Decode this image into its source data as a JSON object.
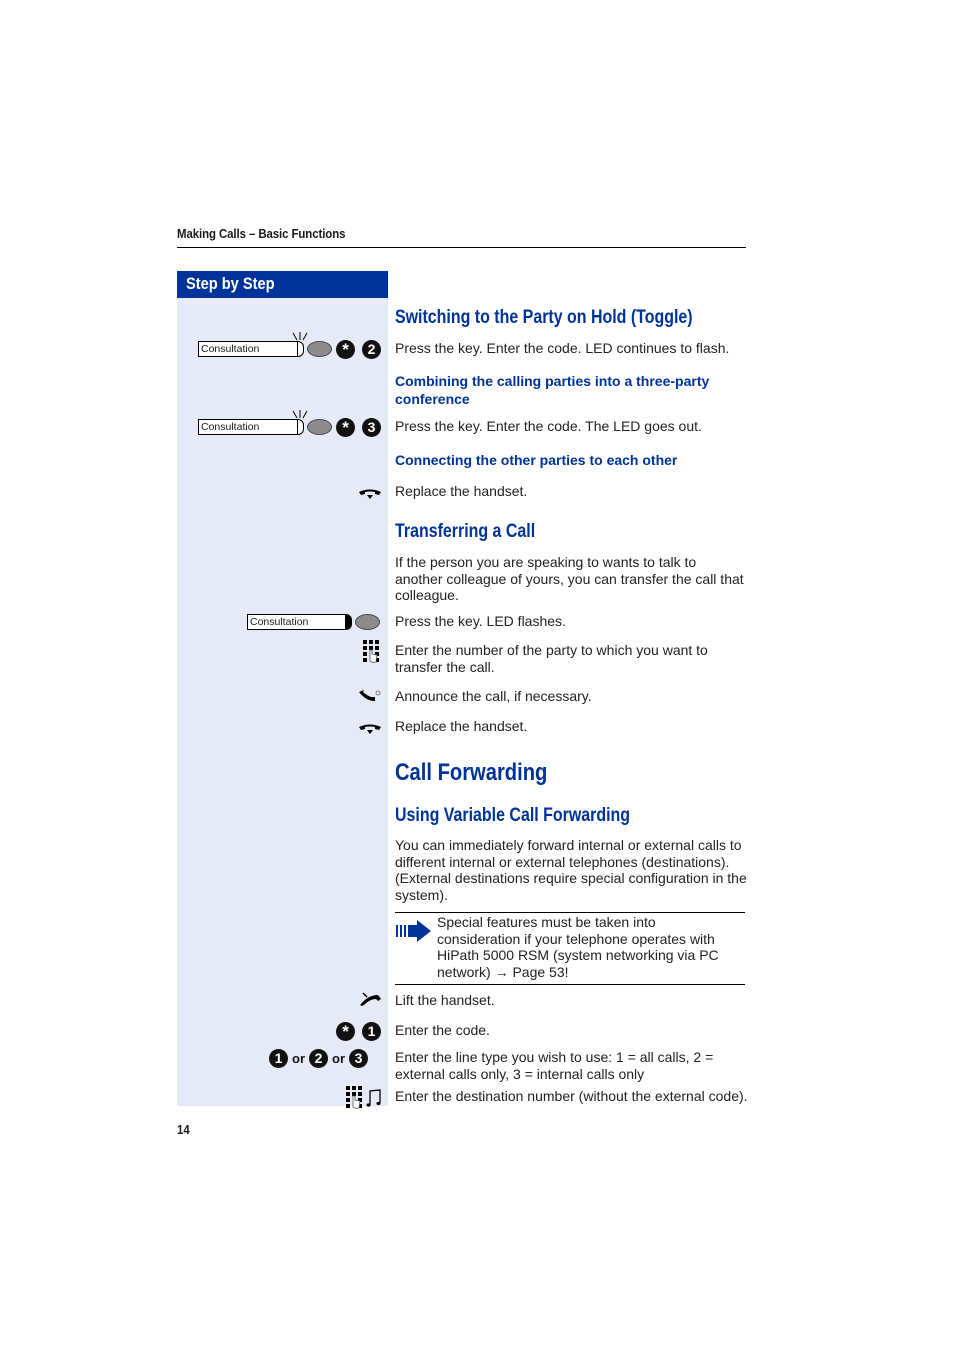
{
  "running_head": "Making Calls – Basic Functions",
  "sidebar_title": "Step by Step",
  "key_label": "Consultation",
  "sections": {
    "toggle": {
      "title": "Switching to the Party on Hold (Toggle)",
      "step1": "Press the key. Enter the code. LED continues to flash.",
      "code": [
        "*",
        "2"
      ]
    },
    "conference": {
      "title": "Combining the calling parties into a three-party conference",
      "step1": "Press the key. Enter the code. The LED goes out.",
      "code": [
        "*",
        "3"
      ]
    },
    "connecting": {
      "title": "Connecting the other parties to each other",
      "step1": "Replace the handset."
    },
    "transfer": {
      "title": "Transferring a Call",
      "intro": "If the person you are speaking to wants to talk to another colleague of yours, you can transfer the call that colleague.",
      "step1": "Press the key. LED flashes.",
      "step2": "Enter the number of the party to which you want to transfer the call.",
      "step3": "Announce the call, if necessary.",
      "step4": "Replace the handset."
    },
    "call_forwarding": {
      "title": "Call Forwarding",
      "subtitle": "Using Variable Call Forwarding",
      "intro": "You can immediately forward internal or external calls to different internal or external telephones (destinations). (External destinations require special configuration in the system).",
      "note": "Special features must be taken into consideration if your telephone operates with HiPath 5000 RSM (system networking via PC network) → Page 53!",
      "step1": "Lift the handset.",
      "step2": "Enter the code.",
      "code": [
        "*",
        "1"
      ],
      "step3": "Enter the line type you wish to use: 1 = all calls, 2 = external calls only, 3 = internal calls only",
      "line_options": [
        "1",
        "2",
        "3"
      ],
      "or_word": "or",
      "step4": "Enter the destination number (without the external code)."
    }
  },
  "page_number": "14",
  "colors": {
    "brand_blue": "#003399",
    "sidebar_bg": "#e5eaf6"
  }
}
